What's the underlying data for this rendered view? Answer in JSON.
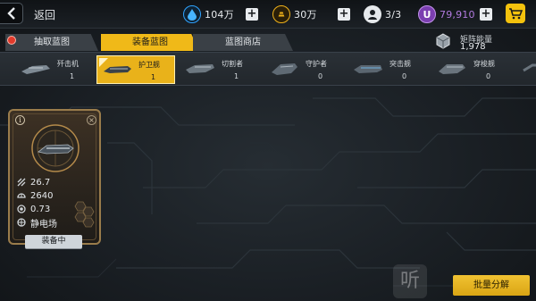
{
  "header": {
    "back_label": "返回",
    "resources": [
      {
        "name": "crystal",
        "value": "104万",
        "color": "#2fa3ff"
      },
      {
        "name": "ore",
        "value": "30万",
        "color": "#f0b21a"
      },
      {
        "name": "pilot",
        "value": "3/3",
        "color": "#cfd4d8"
      },
      {
        "name": "premium",
        "value": "79,910",
        "color": "#9b5cc9"
      }
    ]
  },
  "tabs": [
    {
      "label": "抽取蓝图",
      "active": false
    },
    {
      "label": "装备蓝图",
      "active": true
    },
    {
      "label": "蓝图商店",
      "active": false
    }
  ],
  "matrix": {
    "label": "矩阵能量",
    "value": "1,978"
  },
  "ships": [
    {
      "name": "歼击机",
      "count": "1",
      "active": false
    },
    {
      "name": "护卫舰",
      "count": "1",
      "active": true
    },
    {
      "name": "切割者",
      "count": "1",
      "active": false
    },
    {
      "name": "守护者",
      "count": "0",
      "active": false
    },
    {
      "name": "突击舰",
      "count": "0",
      "active": false
    },
    {
      "name": "穿梭舰",
      "count": "0",
      "active": false
    }
  ],
  "card": {
    "info_glyph": "i",
    "close_glyph": "×",
    "stats": [
      {
        "icon": "speed-icon",
        "value": "26.7"
      },
      {
        "icon": "armor-icon",
        "value": "2640"
      },
      {
        "icon": "shield-icon",
        "value": "0.73"
      },
      {
        "icon": "static-field-icon",
        "value": "静电场"
      }
    ],
    "equip_label": "装备中"
  },
  "watermark_glyph": "听",
  "bulk_decompose_label": "批量分解"
}
